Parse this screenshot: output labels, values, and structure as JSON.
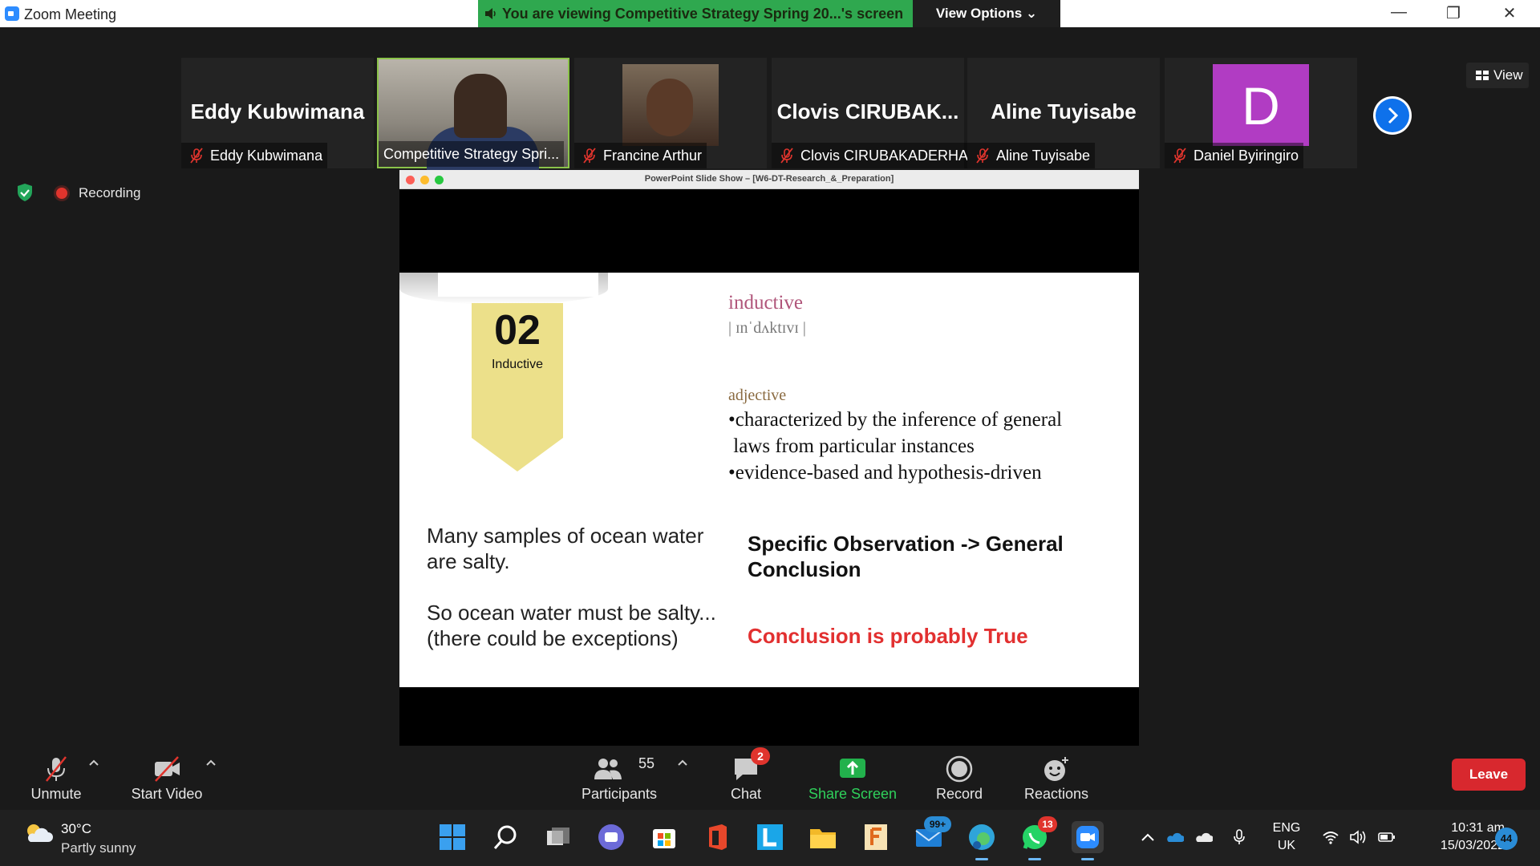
{
  "window": {
    "title": "Zoom Meeting",
    "share_banner": "You are viewing Competitive Strategy Spring 20...'s screen",
    "view_options": "View Options ⌄"
  },
  "gallery": {
    "participants": [
      {
        "display_name": "Eddy Kubwimana",
        "tag": "Eddy Kubwimana",
        "mode": "name"
      },
      {
        "display_name": "",
        "tag": "Competitive Strategy Spri...",
        "mode": "video"
      },
      {
        "display_name": "",
        "tag": "Francine Arthur",
        "mode": "photo"
      },
      {
        "display_name": "Clovis  CIRUBAK...",
        "tag": "Clovis CIRUBAKADERHA",
        "mode": "name"
      },
      {
        "display_name": "Aline Tuyisabe",
        "tag": "Aline Tuyisabe",
        "mode": "name"
      },
      {
        "display_name": "D",
        "tag": "Daniel Byiringiro",
        "mode": "avatar"
      }
    ],
    "view_label": "View"
  },
  "status": {
    "recording_label": "Recording"
  },
  "shared_screen": {
    "window_title": "PowerPoint Slide Show – [W6-DT-Research_&_Preparation]",
    "slide": {
      "number": "02",
      "number_label": "Inductive",
      "word": "inductive",
      "pronunciation": "| ɪnˈdʌktɪvɪ |",
      "part_of_speech": "adjective",
      "def_line1": "•characterized by the inference of general",
      "def_line2": " laws from particular instances",
      "def_line3": "•evidence-based and hypothesis-driven",
      "example1_line1": "Many samples of ocean water",
      "example1_line2": "are salty.",
      "example2_line1": "So ocean water must be salty...",
      "example2_line2": "(there could be exceptions)",
      "flow_line1": "Specific Observation -> General",
      "flow_line2": "Conclusion",
      "conclusion": "Conclusion is probably True"
    }
  },
  "toolbar": {
    "unmute": "Unmute",
    "start_video": "Start Video",
    "participants": "Participants",
    "participants_count": "55",
    "chat": "Chat",
    "chat_badge": "2",
    "share_screen": "Share Screen",
    "record": "Record",
    "reactions": "Reactions",
    "leave": "Leave"
  },
  "taskbar": {
    "weather_temp": "30°C",
    "weather_desc": "Partly sunny",
    "mail_badge": "99+",
    "whatsapp_badge": "13",
    "lang_top": "ENG",
    "lang_bottom": "UK",
    "time": "10:31 am",
    "date": "15/03/2022",
    "notifications": "44"
  },
  "colors": {
    "zoom_blue": "#0e71eb",
    "share_green": "#2fa84f",
    "leave_red": "#d8282e",
    "record_red": "#e0342d"
  }
}
